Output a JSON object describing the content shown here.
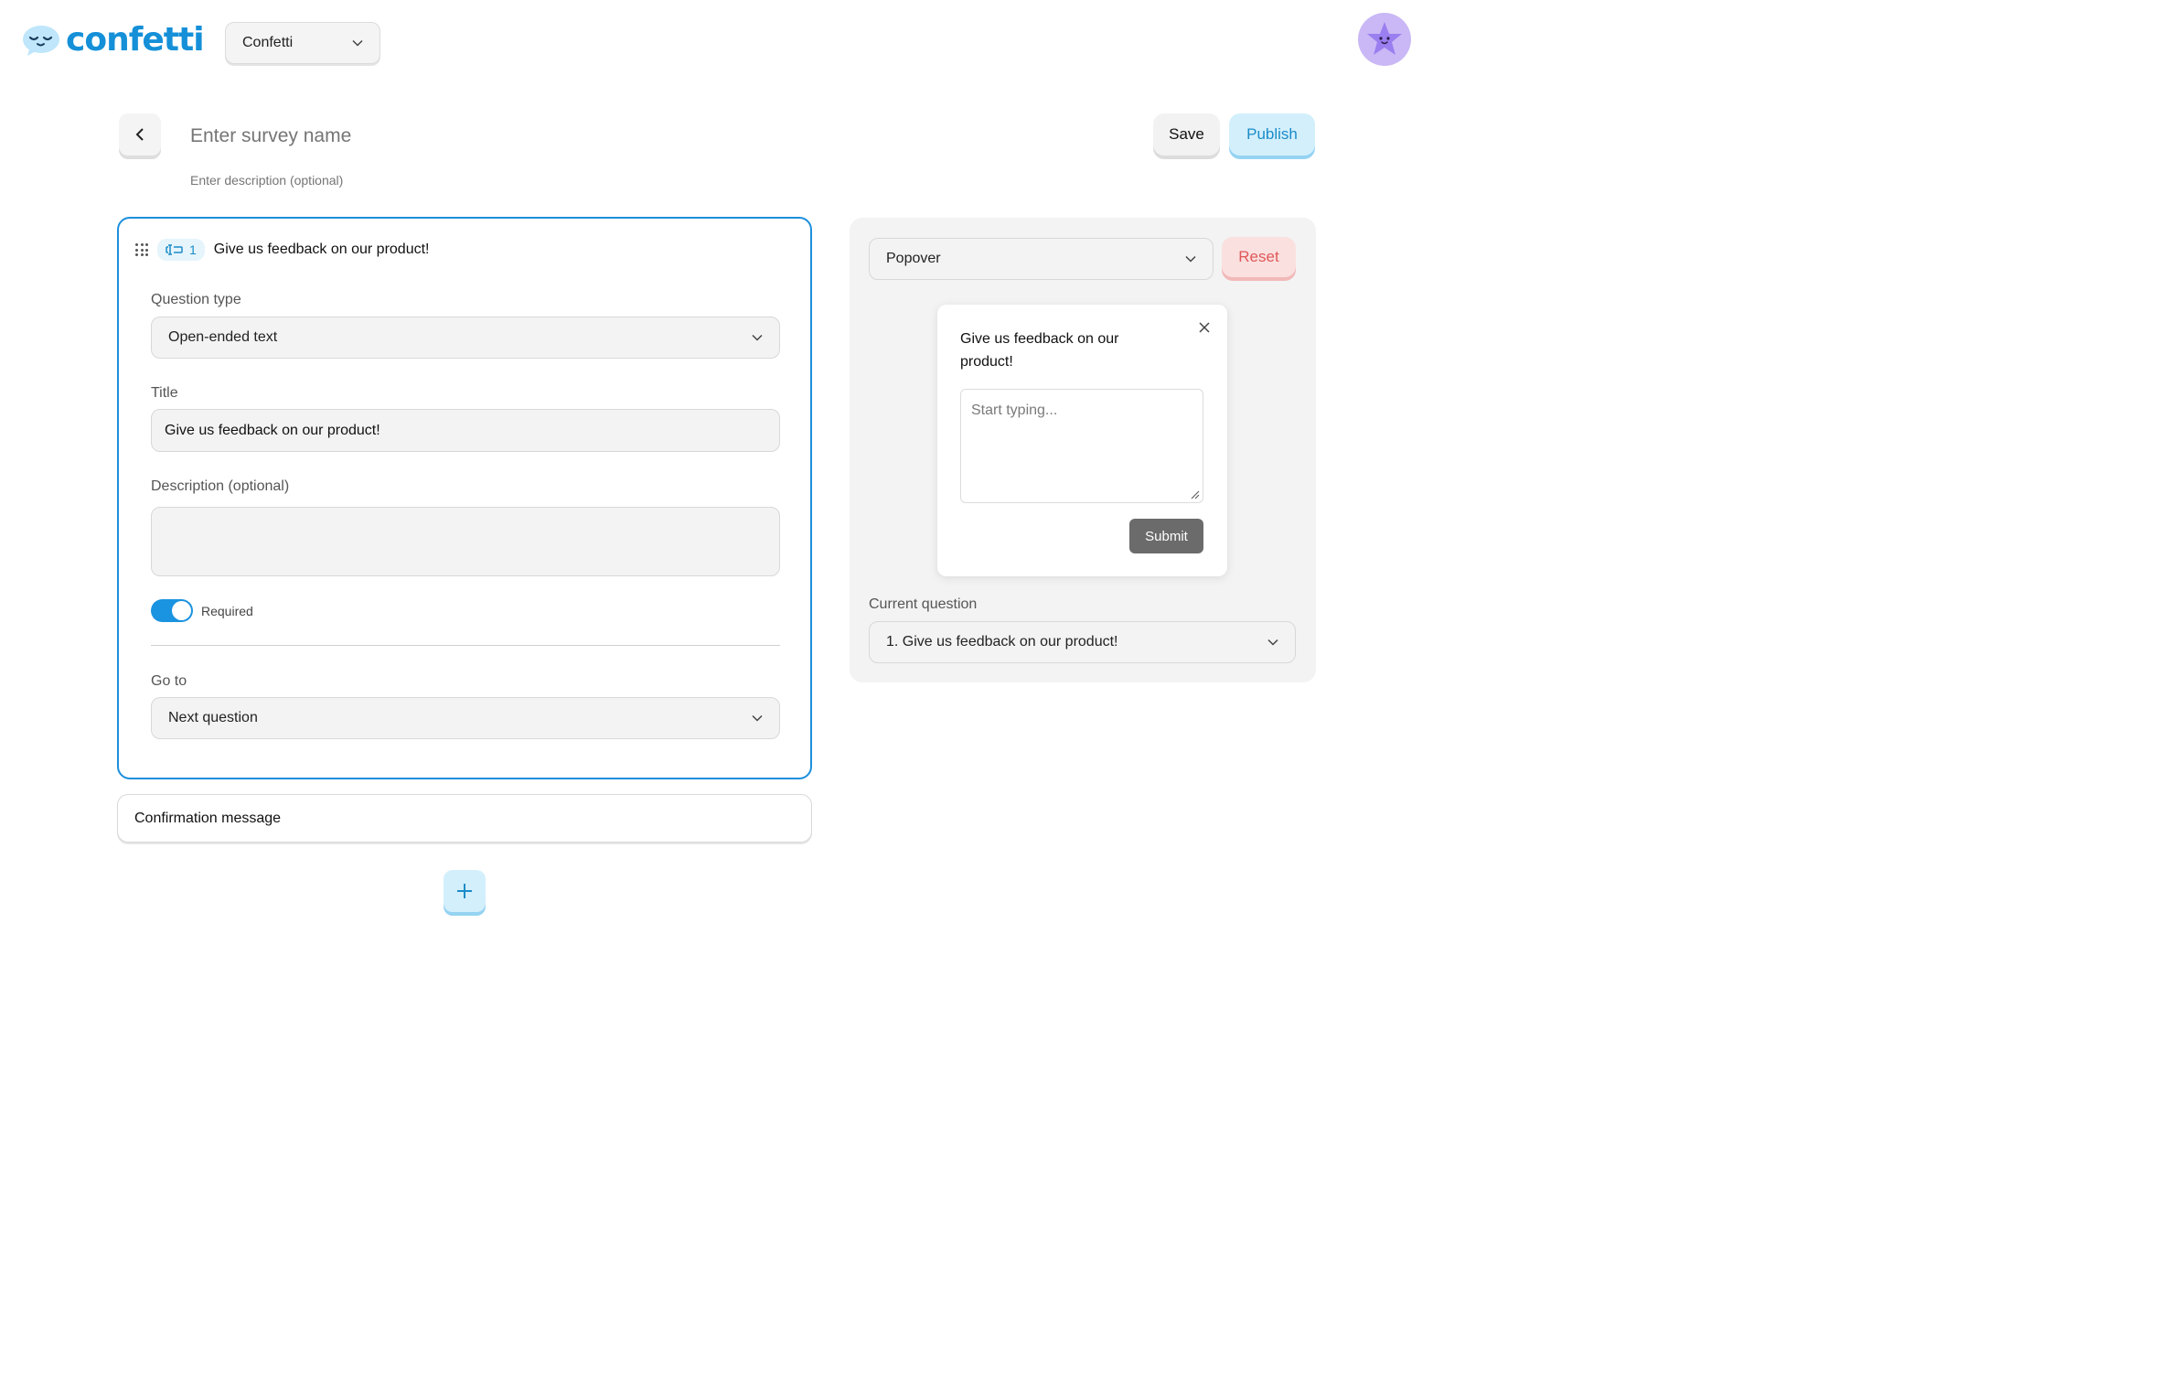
{
  "app": {
    "logo_text": "confetti",
    "workspace": "Confetti"
  },
  "header": {
    "survey_name_placeholder": "Enter survey name",
    "survey_description_placeholder": "Enter description (optional)",
    "save_label": "Save",
    "publish_label": "Publish"
  },
  "question": {
    "number": "1",
    "title": "Give us feedback on our product!",
    "question_type_label": "Question type",
    "question_type_value": "Open-ended text",
    "title_label": "Title",
    "title_value": "Give us feedback on our product!",
    "description_label": "Description (optional)",
    "description_value": "",
    "required_label": "Required",
    "required": true,
    "goto_label": "Go to",
    "goto_value": "Next question"
  },
  "confirmation": {
    "label": "Confirmation message"
  },
  "preview": {
    "display_type": "Popover",
    "reset_label": "Reset",
    "popover_title": "Give us feedback on our product!",
    "popover_placeholder": "Start typing...",
    "submit_label": "Submit",
    "current_question_label": "Current question",
    "current_question_value": "1. Give us feedback on our product!"
  },
  "colors": {
    "brand": "#1590d8",
    "accent_border": "#1d8fdc",
    "publish_bg": "#d3effc",
    "reset_text": "#e05858",
    "toggle_on": "#1a93e0"
  }
}
